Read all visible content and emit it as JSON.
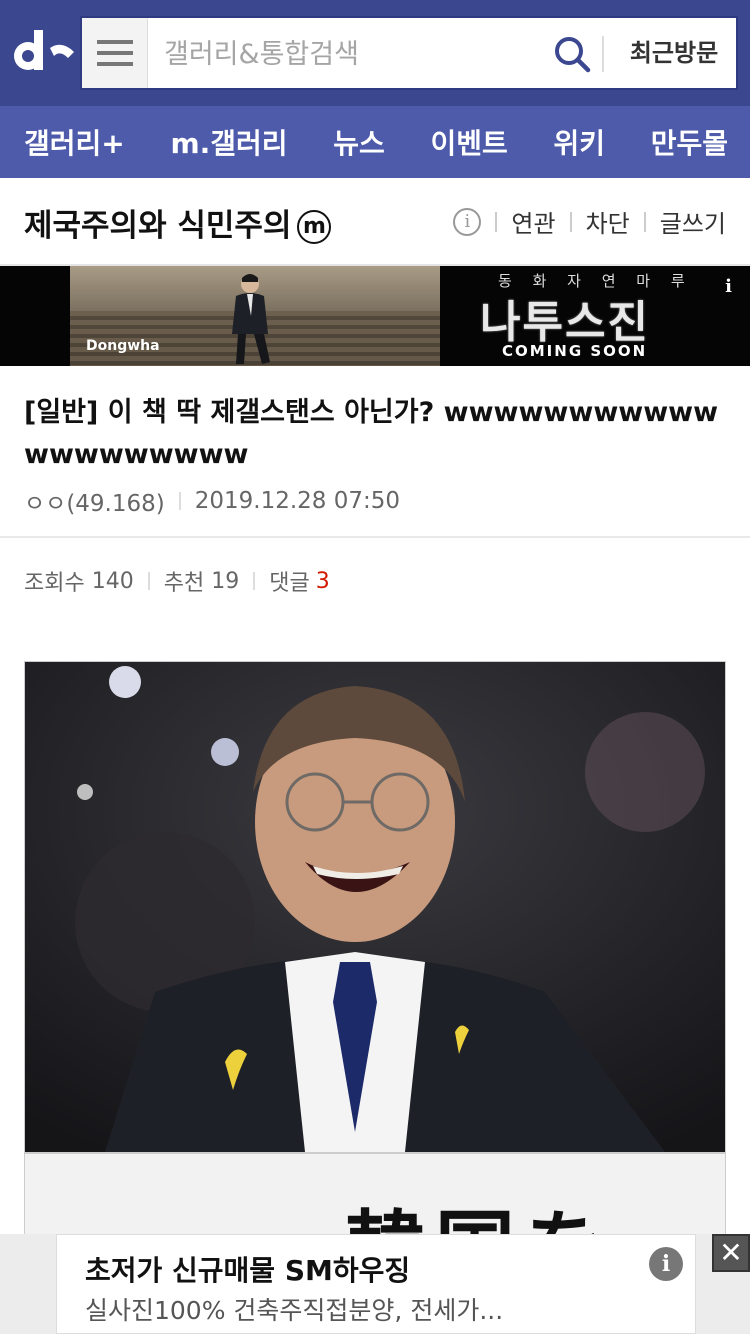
{
  "header": {
    "logo_icon": "dc-logo-icon",
    "menu_icon": "hamburger-menu-icon",
    "search_placeholder": "갤러리&통합검색",
    "search_icon": "search-icon",
    "recent_label": "최근방문",
    "colors": {
      "header_bg": "#3b4890",
      "nav_bg": "#4e5bab"
    }
  },
  "nav": {
    "items": [
      {
        "label": "갤러리+"
      },
      {
        "label": "m.갤러리"
      },
      {
        "label": "뉴스"
      },
      {
        "label": "이벤트"
      },
      {
        "label": "위키"
      },
      {
        "label": "만두몰"
      }
    ]
  },
  "gallery": {
    "title": "제국주의와 식민주의",
    "badge": "m",
    "info_icon": "info-icon",
    "actions": [
      {
        "label": "연관"
      },
      {
        "label": "차단"
      },
      {
        "label": "글쓰기"
      }
    ]
  },
  "ad_banner": {
    "brand": "Dongwha",
    "subtitle": "동 화 자 연 마 루",
    "title": "나투스진",
    "tagline": "COMING SOON",
    "info_label": "i"
  },
  "post": {
    "title": "[일반] 이 책 딱 제갤스탠스 아닌가? wwwwwwwwwwwwwwwwwwww",
    "author": "ㅇㅇ(49.168)",
    "datetime": "2019.12.28 07:50",
    "stats": {
      "views_label": "조회수",
      "views": "140",
      "recommend_label": "추천",
      "recommend": "19",
      "comments_label": "댓글",
      "comments": "3"
    },
    "image_caption_hanja": "韓国を"
  },
  "bottom_ad": {
    "title": "초저가 신규매물 SM하우징",
    "description": "실사진100% 건축주직접분양, 전세가...",
    "info_label": "i",
    "close_label": "✕"
  }
}
